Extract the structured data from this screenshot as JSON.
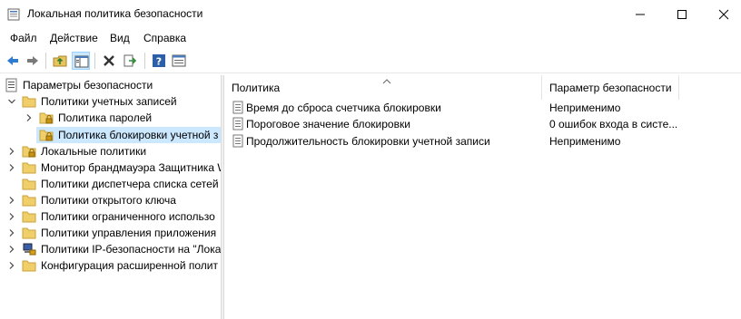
{
  "window": {
    "title": "Локальная политика безопасности",
    "controls": [
      "minimize",
      "maximize",
      "close"
    ]
  },
  "menu": [
    "Файл",
    "Действие",
    "Вид",
    "Справка"
  ],
  "toolbar": {
    "buttons": [
      "back-icon",
      "forward-icon",
      "up-folder-icon",
      "show-tree-icon",
      "delete-icon",
      "export-icon",
      "help-icon",
      "properties-icon"
    ]
  },
  "tree": {
    "root": "Параметры безопасности",
    "items": [
      {
        "label": "Политики учетных записей",
        "expanded": true
      },
      {
        "label": "Политика паролей"
      },
      {
        "label": "Политика блокировки учетной з",
        "selected": true
      },
      {
        "label": "Локальные политики"
      },
      {
        "label": "Монитор брандмауэра Защитника W"
      },
      {
        "label": "Политики диспетчера списка сетей"
      },
      {
        "label": "Политики открытого ключа"
      },
      {
        "label": "Политики ограниченного использо"
      },
      {
        "label": "Политики управления приложения"
      },
      {
        "label": "Политики IP-безопасности на \"Лока"
      },
      {
        "label": "Конфигурация расширенной полит"
      }
    ]
  },
  "list": {
    "columns": [
      "Политика",
      "Параметр безопасности"
    ],
    "rows": [
      {
        "policy": "Время до сброса счетчика блокировки",
        "value": "Неприменимо"
      },
      {
        "policy": "Пороговое значение блокировки",
        "value": "0 ошибок входа в систе..."
      },
      {
        "policy": "Продолжительность блокировки учетной записи",
        "value": "Неприменимо"
      }
    ]
  },
  "colors": {
    "selection": "#cce8ff",
    "folder": "#e8c25a",
    "lock": "#d4a017"
  }
}
